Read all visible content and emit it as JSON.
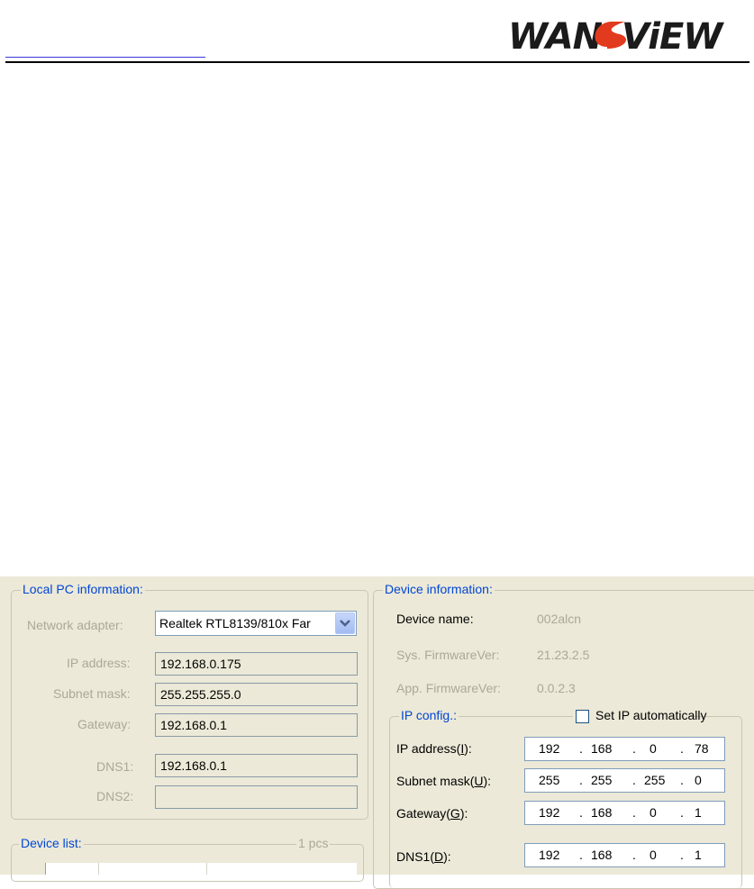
{
  "logo": {
    "text": "WANSVIEW"
  },
  "dialog": {
    "local_pc": {
      "title": "Local PC information:",
      "network_adapter_label": "Network adapter:",
      "network_adapter_value": "Realtek RTL8139/810x Far",
      "ip_label": "IP address:",
      "ip_value": "192.168.0.175",
      "mask_label": "Subnet mask:",
      "mask_value": "255.255.255.0",
      "gateway_label": "Gateway:",
      "gateway_value": "192.168.0.1",
      "dns1_label": "DNS1:",
      "dns1_value": "192.168.0.1",
      "dns2_label": "DNS2:",
      "dns2_value": ""
    },
    "device_list": {
      "title": "Device list:",
      "count": "1 pcs"
    },
    "device_info": {
      "title": "Device information:",
      "name_label": "Device name:",
      "name_value": "002alcn",
      "sys_fw_label": "Sys. FirmwareVer:",
      "sys_fw_value": "21.23.2.5",
      "app_fw_label": "App. FirmwareVer:",
      "app_fw_value": "0.0.2.3"
    },
    "ip_config": {
      "title": "IP config.:",
      "auto_label": "Set IP automatically",
      "auto_checked": false,
      "ip_label_pre": "IP address(",
      "ip_label_key": "I",
      "ip_octets": [
        "192",
        "168",
        "0",
        "78"
      ],
      "mask_label_pre": "Subnet mask(",
      "mask_label_key": "U",
      "mask_octets": [
        "255",
        "255",
        "255",
        "0"
      ],
      "gw_label_pre": "Gateway(",
      "gw_label_key": "G",
      "gw_octets": [
        "192",
        "168",
        "0",
        "1"
      ],
      "dns1_label_pre": "DNS1(",
      "dns1_label_key": "D",
      "dns1_octets": [
        "192",
        "168",
        "0",
        "1"
      ],
      "label_close": "):",
      "dot": "."
    }
  }
}
